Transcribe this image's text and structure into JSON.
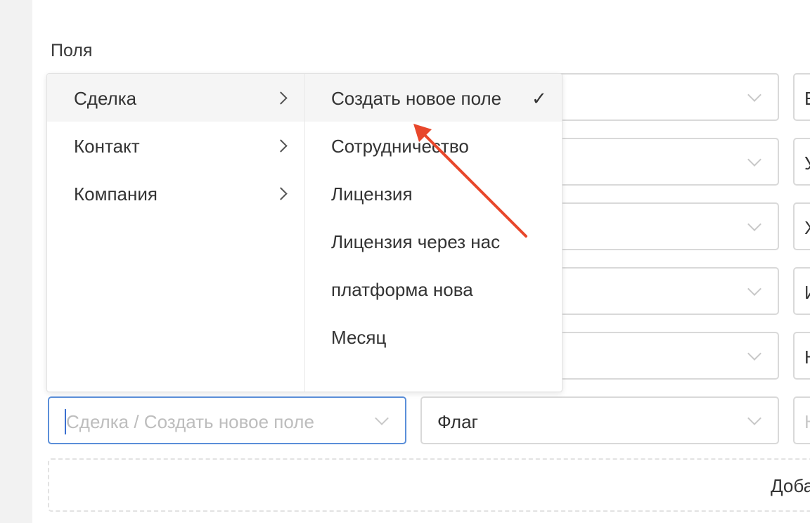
{
  "section_title": "Поля",
  "rows": [
    {
      "field_value": "",
      "type_value": "",
      "extra_value": "E"
    },
    {
      "field_value": "",
      "type_value": "",
      "extra_value": "У"
    },
    {
      "field_value": "",
      "type_value": "",
      "extra_value": "Х"
    },
    {
      "field_value": "",
      "type_value": "",
      "extra_value": "И"
    },
    {
      "field_value": "",
      "type_value": "",
      "extra_value": "Н"
    },
    {
      "field_placeholder": "Сделка / Создать новое поле",
      "type_value": "Флаг",
      "extra_placeholder": "Н"
    }
  ],
  "dropdown": {
    "categories": [
      {
        "label": "Сделка",
        "active": true
      },
      {
        "label": "Контакт",
        "active": false
      },
      {
        "label": "Компания",
        "active": false
      }
    ],
    "fields": [
      {
        "label": "Создать новое поле",
        "selected": true
      },
      {
        "label": "Сотрудничество",
        "selected": false
      },
      {
        "label": "Лицензия",
        "selected": false
      },
      {
        "label": "Лицензия через нас",
        "selected": false
      },
      {
        "label": "платформа нова",
        "selected": false
      },
      {
        "label": "Месяц",
        "selected": false
      }
    ],
    "check_glyph": "✓"
  },
  "add_button_label": "Доба",
  "colors": {
    "accent_border": "#5b8fd9",
    "annotation_arrow": "#e8472b"
  }
}
